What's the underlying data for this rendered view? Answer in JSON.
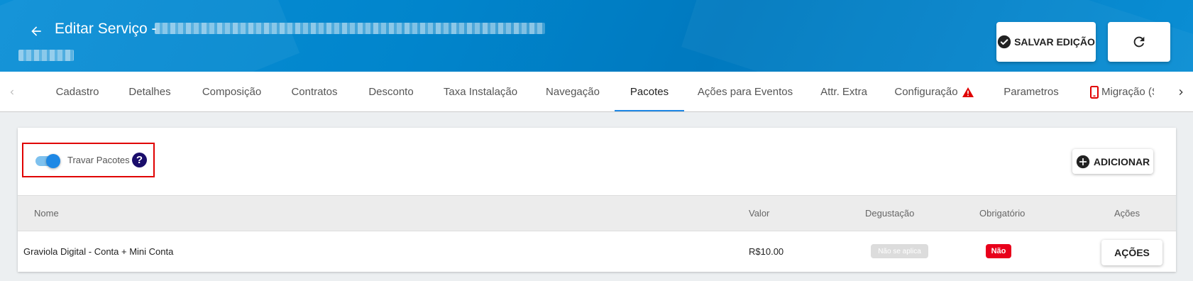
{
  "header": {
    "title": "Editar Serviço -",
    "save_label": "SALVAR EDIÇÃO"
  },
  "tabs": [
    {
      "label": "Cadastro"
    },
    {
      "label": "Detalhes"
    },
    {
      "label": "Composição"
    },
    {
      "label": "Contratos"
    },
    {
      "label": "Desconto"
    },
    {
      "label": "Taxa Instalação"
    },
    {
      "label": "Navegação"
    },
    {
      "label": "Pacotes",
      "active": true
    },
    {
      "label": "Ações para Eventos"
    },
    {
      "label": "Attr. Extra"
    },
    {
      "label": "Configuração"
    },
    {
      "label": "Parametros"
    },
    {
      "label": "Migração (S"
    }
  ],
  "packages": {
    "lock_label": "Travar Pacotes",
    "lock_enabled": true,
    "help_glyph": "?",
    "add_label": "ADICIONAR",
    "columns": [
      "Nome",
      "Valor",
      "Degustação",
      "Obrigatório",
      "Ações"
    ],
    "rows": [
      {
        "name": "Graviola Digital - Conta + Mini Conta",
        "value": "R$10.00",
        "tasting": "Não se aplica",
        "required": "Não",
        "actions_label": "AÇÕES"
      }
    ]
  },
  "colors": {
    "header_bg": "#0185cc",
    "accent": "#1e88e5",
    "required_no": "#e8001b",
    "highlight_border": "#e00000"
  },
  "icons": {
    "back": "arrow-left-icon",
    "save": "check-circle-icon",
    "refresh": "refresh-icon",
    "warning": "warning-icon",
    "phone": "phone-icon",
    "add": "plus-circle-icon",
    "help": "help-icon"
  }
}
